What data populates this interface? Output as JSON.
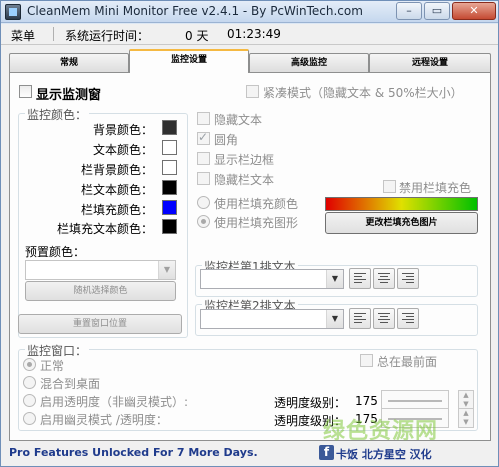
{
  "window": {
    "title": "CleanMem Mini Monitor Free v2.4.1 - By PcWinTech.com",
    "minimize_glyph": "–",
    "maximize_glyph": "▭",
    "close_glyph": "✕"
  },
  "menubar": {
    "menu_label": "菜单",
    "uptime_label": "系统运行时间：",
    "uptime_days": "0 天",
    "uptime_time": "01:23:49"
  },
  "tabs": [
    {
      "label": "常规"
    },
    {
      "label": "监控设置"
    },
    {
      "label": "高级监控"
    },
    {
      "label": "远程设置"
    }
  ],
  "panel": {
    "show_monitor_label": "显示监测窗",
    "show_monitor_checked": false,
    "compact_mode_label": "紧凑模式（隐藏文本 & 50%栏大小）",
    "colors_group": "监控颜色：",
    "color_rows": [
      {
        "label": "背景颜色：",
        "color": "#2f2f2f"
      },
      {
        "label": "文本颜色：",
        "color": "#ffffff"
      },
      {
        "label": "栏背景颜色：",
        "color": "#ffffff"
      },
      {
        "label": "栏文本颜色：",
        "color": "#000000"
      },
      {
        "label": "栏填充颜色：",
        "color": "#0000ff"
      },
      {
        "label": "栏填充文本颜色：",
        "color": "#000000"
      }
    ],
    "preset_label": "预置颜色：",
    "preset_value": "",
    "random_button": "随机选择颜色",
    "reset_window_button": "重置窗口位置",
    "options": [
      {
        "label": "隐藏文本",
        "checked": false
      },
      {
        "label": "圆角",
        "checked": true
      },
      {
        "label": "显示栏边框",
        "checked": false
      },
      {
        "label": "隐藏栏文本",
        "checked": false
      }
    ],
    "disable_fill_label": "禁用栏填充色",
    "fill_color_radio": "使用栏填充颜色",
    "fill_image_radio": "使用栏填充图形",
    "fill_image_selected": true,
    "change_image_button": "更改栏填充色图片",
    "text1_group": "监控栏第1排文本",
    "text2_group": "监控栏第2排文本",
    "text1_value": "",
    "text2_value": "",
    "monitor_window_group": "监控窗口：",
    "window_modes": [
      {
        "label": "正常",
        "selected": true
      },
      {
        "label": "混合到桌面",
        "selected": false
      },
      {
        "label": "启用透明度（非幽灵模式）:",
        "selected": false
      },
      {
        "label": "启用幽灵模式 /透明度：",
        "selected": false
      }
    ],
    "always_on_top_label": "总在最前面",
    "opacity_label_1": "透明度级别：",
    "opacity_value_1": "175",
    "opacity_label_2": "透明度级别：",
    "opacity_value_2": "175"
  },
  "status": {
    "promo": "Pro Features Unlocked For 7 More Days.",
    "facebook_glyph": "f",
    "right_text": "卡饭 北方星空 汉化"
  },
  "watermark": "绿色资源网"
}
